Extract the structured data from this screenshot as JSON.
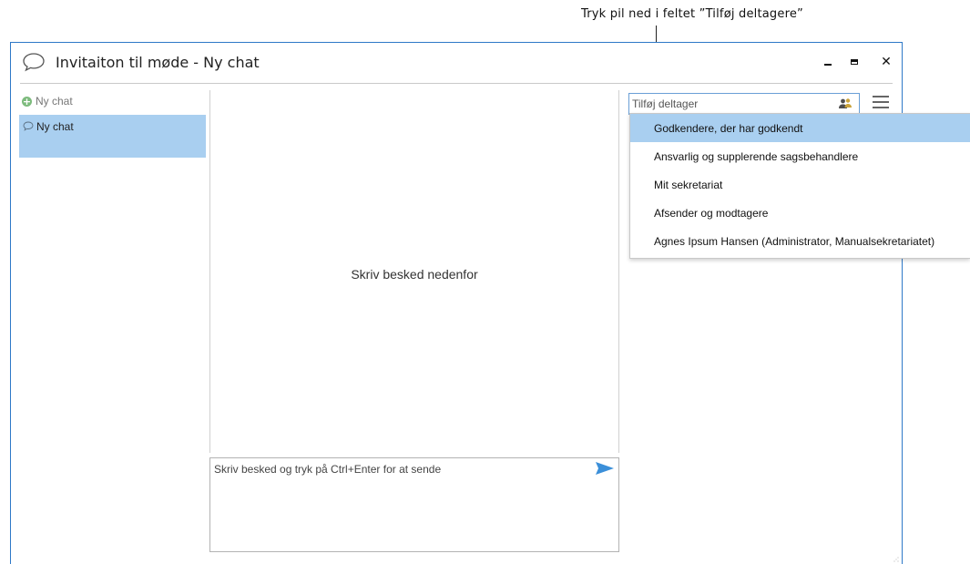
{
  "annotation": {
    "text": "Tryk pil ned i feltet ”Tilføj deltagere”"
  },
  "window": {
    "title": "Invitaiton til møde - Ny chat",
    "minimize_icon": "minimize-icon",
    "maximize_icon": "maximize-icon",
    "close_glyph": "✕"
  },
  "sidebar": {
    "new_chat_label": "Ny chat",
    "chats": [
      {
        "label": "Ny chat",
        "selected": true
      }
    ]
  },
  "conversation": {
    "empty_text": "Skriv besked nedenfor",
    "message_placeholder": "Skriv besked og tryk på Ctrl+Enter for at sende"
  },
  "participants": {
    "placeholder": "Tilføj deltager",
    "options": [
      {
        "label": "Godkendere, der har godkendt",
        "selected": true
      },
      {
        "label": "Ansvarlig og supplerende sagsbehandlere",
        "selected": false
      },
      {
        "label": "Mit sekretariat",
        "selected": false
      },
      {
        "label": "Afsender og modtagere",
        "selected": false
      },
      {
        "label": "Agnes Ipsum Hansen (Administrator, Manualsekretariatet)",
        "selected": false
      }
    ]
  },
  "colors": {
    "accent": "#2e78c7",
    "selection": "#a9cff0",
    "send": "#3b8fd9",
    "add_green": "#7dbb7d"
  }
}
